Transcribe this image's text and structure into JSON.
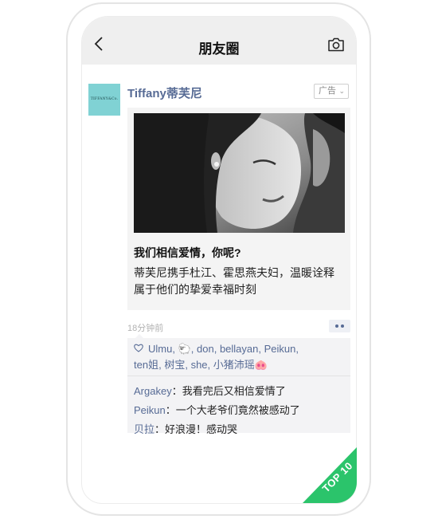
{
  "nav": {
    "title": "朋友圈"
  },
  "post": {
    "author": "Tiffany蒂芙尼",
    "avatar_text": "TIFFANY&Co.",
    "ad_label": "广告",
    "card": {
      "title": "我们相信爱情，你呢?",
      "description": "蒂芙尼携手杜江、霍思燕夫妇，温暖诠释属于他们的挚爱幸福时刻"
    },
    "time": "18分钟前"
  },
  "likes": [
    "Ulmu",
    "don",
    "bellayan",
    "Peikun",
    "ten姐",
    "树宝",
    "she",
    "小猪沛瑶"
  ],
  "comments": [
    {
      "user": "Argakey",
      "text": "我看完后又相信爱情了"
    },
    {
      "user": "Peikun",
      "text": "一个大老爷们竟然被感动了"
    },
    {
      "user": "贝拉",
      "text": "好浪漫！感动哭"
    }
  ],
  "badge": {
    "text": "TOP 10",
    "color": "#2bc46b"
  },
  "icons": [
    "chevron-left-icon",
    "camera-icon",
    "heart-icon",
    "more-dots-icon",
    "sheep-emoji",
    "pig-emoji"
  ]
}
